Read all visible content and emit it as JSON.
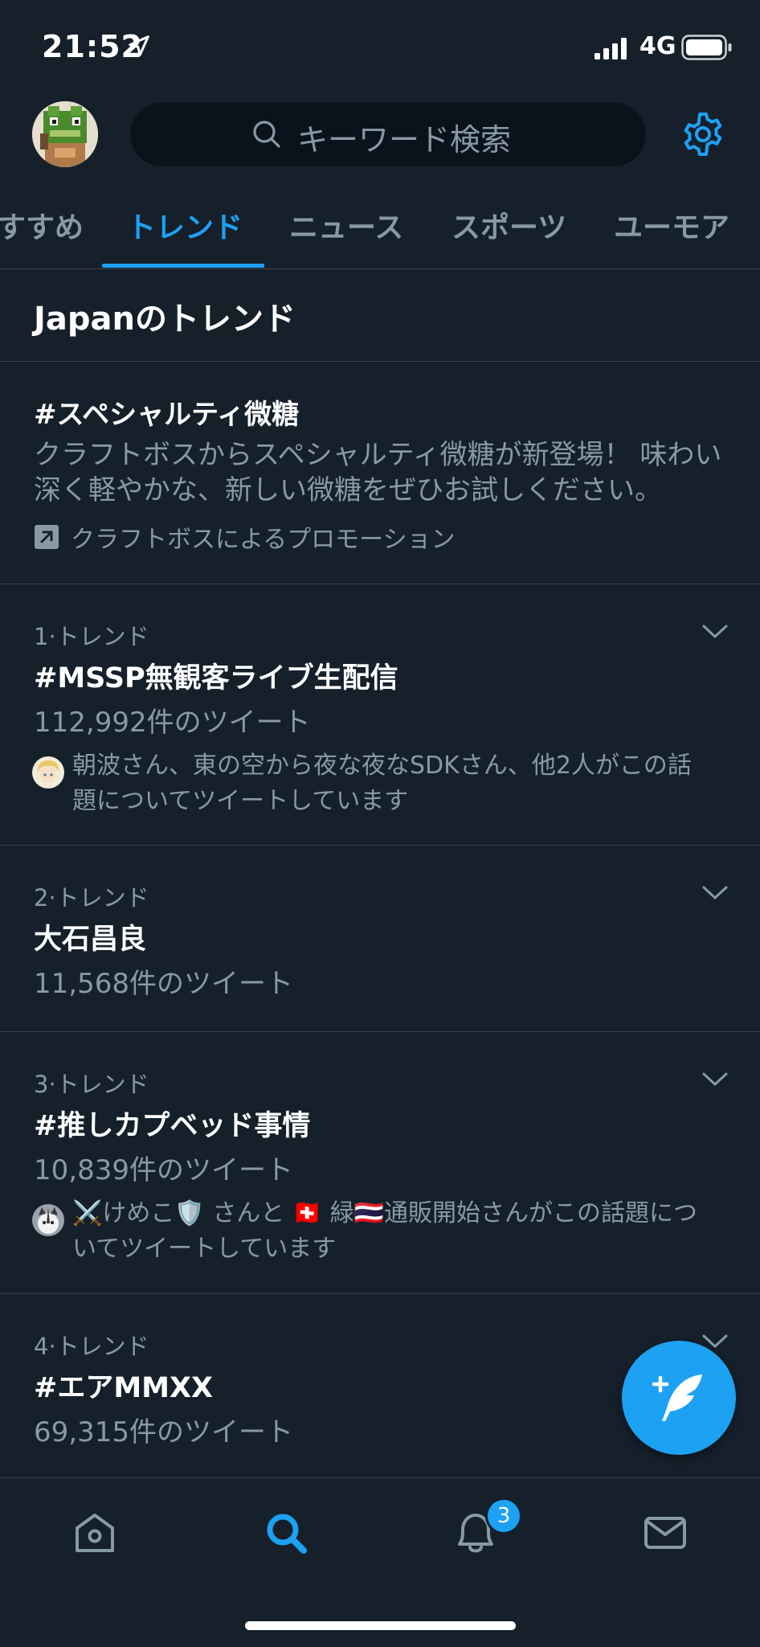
{
  "status_bar": {
    "time": "21:52",
    "network": "4G"
  },
  "header": {
    "search_placeholder": "キーワード検索"
  },
  "tabs": [
    {
      "label": "すすめ"
    },
    {
      "label": "トレンド"
    },
    {
      "label": "ニュース"
    },
    {
      "label": "スポーツ"
    },
    {
      "label": "ユーモア"
    }
  ],
  "active_tab": "トレンド",
  "section_title": "Japanのトレンド",
  "promoted": {
    "title": "#スペシャルティ微糖",
    "description": "クラフトボスからスペシャルティ微糖が新登場！ 味わい深く軽やかな、新しい微糖をぜひお試しください。",
    "promoted_by": "クラフトボスによるプロモーション"
  },
  "trends": [
    {
      "meta": "1·トレンド",
      "name": "#MSSP無観客ライブ生配信",
      "count": "112,992件のツイート",
      "context": "朝波さん、東の空から夜な夜なSDKさん、他2人がこの話題についてツイートしています"
    },
    {
      "meta": "2·トレンド",
      "name": "大石昌良",
      "count": "11,568件のツイート"
    },
    {
      "meta": "3·トレンド",
      "name": "#推しカプベッド事情",
      "count": "10,839件のツイート",
      "context": "⚔️けめこ🛡️ さんと 🇨🇭 緑🇹🇭通販開始さんがこの話題についてツイートしています"
    },
    {
      "meta": "4·トレンド",
      "name": "#エアMMXX",
      "count": "69,315件のツイート"
    }
  ],
  "bottom_nav": {
    "notifications_badge": "3"
  },
  "colors": {
    "background": "#15202b",
    "accent": "#1da1f2",
    "secondary_text": "#8899a6",
    "divider": "#38444d"
  }
}
